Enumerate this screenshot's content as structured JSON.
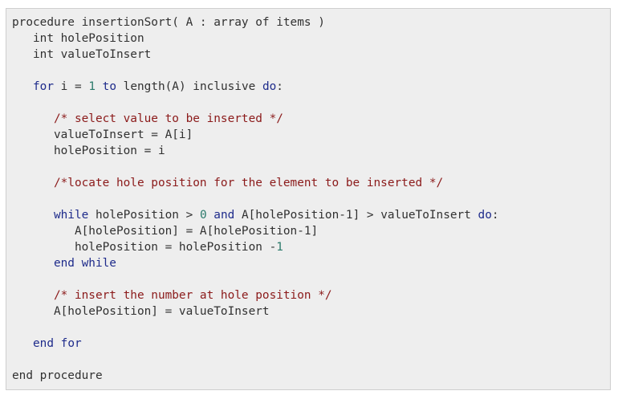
{
  "code": {
    "language": "pseudocode",
    "colors": {
      "background": "#eeeeee",
      "border": "#cfcfcf",
      "text": "#313131",
      "keyword": "#1e2b8b",
      "comment": "#8b1a1a",
      "number": "#2b7a6b"
    },
    "lines": [
      [
        {
          "t": "procedure insertionSort( A : array of items )",
          "c": ""
        }
      ],
      [
        {
          "t": "   int holePosition",
          "c": ""
        }
      ],
      [
        {
          "t": "   int valueToInsert",
          "c": ""
        }
      ],
      [],
      [
        {
          "t": "   ",
          "c": ""
        },
        {
          "t": "for",
          "c": "kw"
        },
        {
          "t": " i = ",
          "c": ""
        },
        {
          "t": "1",
          "c": "num"
        },
        {
          "t": " ",
          "c": ""
        },
        {
          "t": "to",
          "c": "kw"
        },
        {
          "t": " length(A) inclusive ",
          "c": ""
        },
        {
          "t": "do",
          "c": "kw"
        },
        {
          "t": ":",
          "c": ""
        }
      ],
      [],
      [
        {
          "t": "      ",
          "c": ""
        },
        {
          "t": "/* select value to be inserted */",
          "c": "cm"
        }
      ],
      [
        {
          "t": "      valueToInsert = A[i]",
          "c": ""
        }
      ],
      [
        {
          "t": "      holePosition = i",
          "c": ""
        }
      ],
      [],
      [
        {
          "t": "      ",
          "c": ""
        },
        {
          "t": "/*locate hole position for the element to be inserted */",
          "c": "cm"
        }
      ],
      [],
      [
        {
          "t": "      ",
          "c": ""
        },
        {
          "t": "while",
          "c": "kw"
        },
        {
          "t": " holePosition > ",
          "c": ""
        },
        {
          "t": "0",
          "c": "num"
        },
        {
          "t": " ",
          "c": ""
        },
        {
          "t": "and",
          "c": "kw"
        },
        {
          "t": " A[holePosition-1] > valueToInsert ",
          "c": ""
        },
        {
          "t": "do",
          "c": "kw"
        },
        {
          "t": ":",
          "c": ""
        }
      ],
      [
        {
          "t": "         A[holePosition] = A[holePosition-1]",
          "c": ""
        }
      ],
      [
        {
          "t": "         holePosition = holePosition -",
          "c": ""
        },
        {
          "t": "1",
          "c": "num"
        }
      ],
      [
        {
          "t": "      ",
          "c": ""
        },
        {
          "t": "end while",
          "c": "kw"
        }
      ],
      [],
      [
        {
          "t": "      ",
          "c": ""
        },
        {
          "t": "/* insert the number at hole position */",
          "c": "cm"
        }
      ],
      [
        {
          "t": "      A[holePosition] = valueToInsert",
          "c": ""
        }
      ],
      [],
      [
        {
          "t": "   ",
          "c": ""
        },
        {
          "t": "end for",
          "c": "kw"
        }
      ],
      [],
      [
        {
          "t": "end procedure",
          "c": ""
        }
      ]
    ]
  }
}
